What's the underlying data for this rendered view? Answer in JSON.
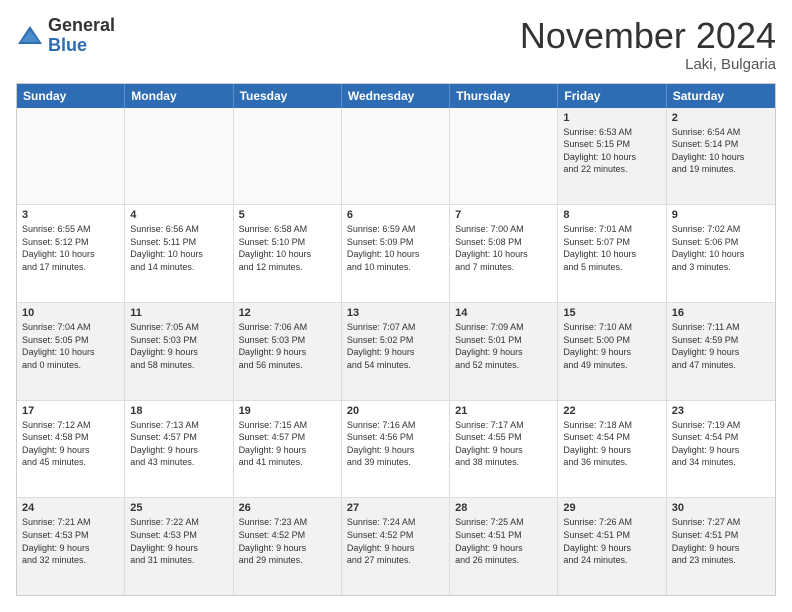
{
  "logo": {
    "general": "General",
    "blue": "Blue"
  },
  "header": {
    "month": "November 2024",
    "location": "Laki, Bulgaria"
  },
  "weekdays": [
    "Sunday",
    "Monday",
    "Tuesday",
    "Wednesday",
    "Thursday",
    "Friday",
    "Saturday"
  ],
  "weeks": [
    [
      {
        "day": "",
        "info": "",
        "empty": true
      },
      {
        "day": "",
        "info": "",
        "empty": true
      },
      {
        "day": "",
        "info": "",
        "empty": true
      },
      {
        "day": "",
        "info": "",
        "empty": true
      },
      {
        "day": "",
        "info": "",
        "empty": true
      },
      {
        "day": "1",
        "info": "Sunrise: 6:53 AM\nSunset: 5:15 PM\nDaylight: 10 hours\nand 22 minutes."
      },
      {
        "day": "2",
        "info": "Sunrise: 6:54 AM\nSunset: 5:14 PM\nDaylight: 10 hours\nand 19 minutes."
      }
    ],
    [
      {
        "day": "3",
        "info": "Sunrise: 6:55 AM\nSunset: 5:12 PM\nDaylight: 10 hours\nand 17 minutes."
      },
      {
        "day": "4",
        "info": "Sunrise: 6:56 AM\nSunset: 5:11 PM\nDaylight: 10 hours\nand 14 minutes."
      },
      {
        "day": "5",
        "info": "Sunrise: 6:58 AM\nSunset: 5:10 PM\nDaylight: 10 hours\nand 12 minutes."
      },
      {
        "day": "6",
        "info": "Sunrise: 6:59 AM\nSunset: 5:09 PM\nDaylight: 10 hours\nand 10 minutes."
      },
      {
        "day": "7",
        "info": "Sunrise: 7:00 AM\nSunset: 5:08 PM\nDaylight: 10 hours\nand 7 minutes."
      },
      {
        "day": "8",
        "info": "Sunrise: 7:01 AM\nSunset: 5:07 PM\nDaylight: 10 hours\nand 5 minutes."
      },
      {
        "day": "9",
        "info": "Sunrise: 7:02 AM\nSunset: 5:06 PM\nDaylight: 10 hours\nand 3 minutes."
      }
    ],
    [
      {
        "day": "10",
        "info": "Sunrise: 7:04 AM\nSunset: 5:05 PM\nDaylight: 10 hours\nand 0 minutes."
      },
      {
        "day": "11",
        "info": "Sunrise: 7:05 AM\nSunset: 5:03 PM\nDaylight: 9 hours\nand 58 minutes."
      },
      {
        "day": "12",
        "info": "Sunrise: 7:06 AM\nSunset: 5:03 PM\nDaylight: 9 hours\nand 56 minutes."
      },
      {
        "day": "13",
        "info": "Sunrise: 7:07 AM\nSunset: 5:02 PM\nDaylight: 9 hours\nand 54 minutes."
      },
      {
        "day": "14",
        "info": "Sunrise: 7:09 AM\nSunset: 5:01 PM\nDaylight: 9 hours\nand 52 minutes."
      },
      {
        "day": "15",
        "info": "Sunrise: 7:10 AM\nSunset: 5:00 PM\nDaylight: 9 hours\nand 49 minutes."
      },
      {
        "day": "16",
        "info": "Sunrise: 7:11 AM\nSunset: 4:59 PM\nDaylight: 9 hours\nand 47 minutes."
      }
    ],
    [
      {
        "day": "17",
        "info": "Sunrise: 7:12 AM\nSunset: 4:58 PM\nDaylight: 9 hours\nand 45 minutes."
      },
      {
        "day": "18",
        "info": "Sunrise: 7:13 AM\nSunset: 4:57 PM\nDaylight: 9 hours\nand 43 minutes."
      },
      {
        "day": "19",
        "info": "Sunrise: 7:15 AM\nSunset: 4:57 PM\nDaylight: 9 hours\nand 41 minutes."
      },
      {
        "day": "20",
        "info": "Sunrise: 7:16 AM\nSunset: 4:56 PM\nDaylight: 9 hours\nand 39 minutes."
      },
      {
        "day": "21",
        "info": "Sunrise: 7:17 AM\nSunset: 4:55 PM\nDaylight: 9 hours\nand 38 minutes."
      },
      {
        "day": "22",
        "info": "Sunrise: 7:18 AM\nSunset: 4:54 PM\nDaylight: 9 hours\nand 36 minutes."
      },
      {
        "day": "23",
        "info": "Sunrise: 7:19 AM\nSunset: 4:54 PM\nDaylight: 9 hours\nand 34 minutes."
      }
    ],
    [
      {
        "day": "24",
        "info": "Sunrise: 7:21 AM\nSunset: 4:53 PM\nDaylight: 9 hours\nand 32 minutes."
      },
      {
        "day": "25",
        "info": "Sunrise: 7:22 AM\nSunset: 4:53 PM\nDaylight: 9 hours\nand 31 minutes."
      },
      {
        "day": "26",
        "info": "Sunrise: 7:23 AM\nSunset: 4:52 PM\nDaylight: 9 hours\nand 29 minutes."
      },
      {
        "day": "27",
        "info": "Sunrise: 7:24 AM\nSunset: 4:52 PM\nDaylight: 9 hours\nand 27 minutes."
      },
      {
        "day": "28",
        "info": "Sunrise: 7:25 AM\nSunset: 4:51 PM\nDaylight: 9 hours\nand 26 minutes."
      },
      {
        "day": "29",
        "info": "Sunrise: 7:26 AM\nSunset: 4:51 PM\nDaylight: 9 hours\nand 24 minutes."
      },
      {
        "day": "30",
        "info": "Sunrise: 7:27 AM\nSunset: 4:51 PM\nDaylight: 9 hours\nand 23 minutes."
      }
    ]
  ]
}
